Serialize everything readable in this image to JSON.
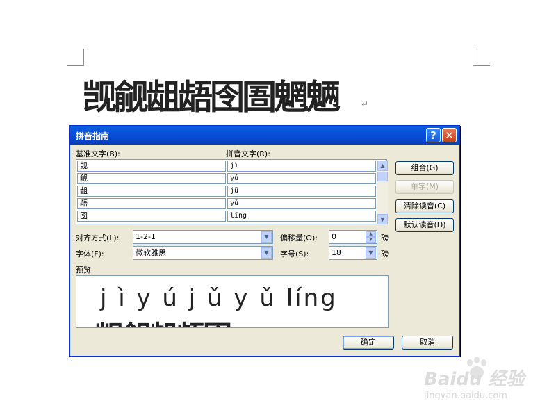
{
  "document": {
    "text": "觊觎龃龉囹圄魍魉",
    "paragraph_mark": "↵"
  },
  "dialog": {
    "title": "拼音指南",
    "help_button": "?",
    "close_button": "✕",
    "base_text_label": "基准文字(B):",
    "pinyin_text_label": "拼音文字(R):",
    "rows": [
      {
        "base": "觊",
        "pinyin": "jì"
      },
      {
        "base": "觎",
        "pinyin": "yú"
      },
      {
        "base": "龃",
        "pinyin": "jǔ"
      },
      {
        "base": "龉",
        "pinyin": "yǔ"
      },
      {
        "base": "囹",
        "pinyin": "líng"
      }
    ],
    "buttons": {
      "combine": "组合(G)",
      "single_char": "单字(M)",
      "clear_pinyin": "清除读音(C)",
      "default_pinyin": "默认读音(D)",
      "ok": "确定",
      "cancel": "取消"
    },
    "alignment": {
      "label": "对齐方式(L):",
      "value": "1-2-1"
    },
    "offset": {
      "label": "偏移量(O):",
      "value": "0",
      "unit": "磅"
    },
    "font": {
      "label": "字体(F):",
      "value": "微软雅黑"
    },
    "size": {
      "label": "字号(S):",
      "value": "18",
      "unit": "磅"
    },
    "preview_label": "预览",
    "preview": {
      "pinyin": "j ì y ú j ǔ y ǔ líng",
      "text": "觊觎龃龉囹"
    }
  },
  "watermark": {
    "brand": "Baidu 经验",
    "url": "jingyan.baidu.com"
  }
}
